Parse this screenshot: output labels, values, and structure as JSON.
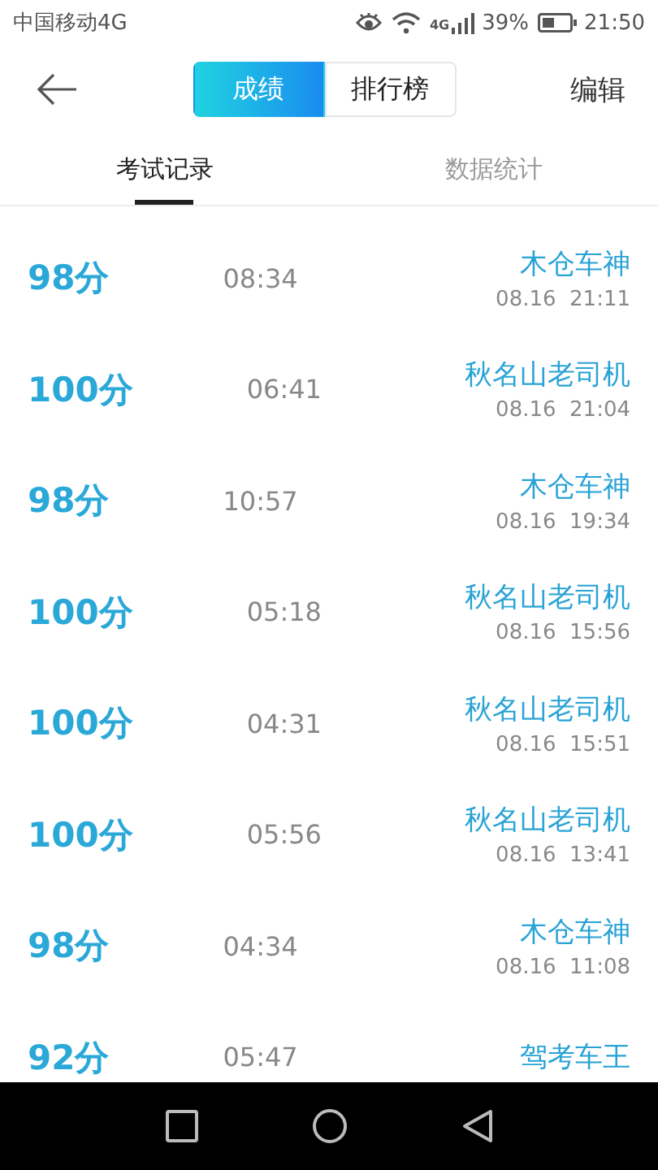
{
  "status_bar": {
    "carrier": "中国移动4G",
    "network": "4G",
    "battery": "39%",
    "time": "21:50"
  },
  "header": {
    "segments": [
      {
        "label": "成绩",
        "selected": true
      },
      {
        "label": "排行榜",
        "selected": false
      }
    ],
    "action": "编辑"
  },
  "tabs": [
    {
      "label": "考试记录",
      "selected": true
    },
    {
      "label": "数据统计",
      "selected": false
    }
  ],
  "records": [
    {
      "score": "98分",
      "duration": "08:34",
      "name": "木仓车神",
      "date": "08.16  21:11"
    },
    {
      "score": "100分",
      "duration": "06:41",
      "name": "秋名山老司机",
      "date": "08.16  21:04"
    },
    {
      "score": "98分",
      "duration": "10:57",
      "name": "木仓车神",
      "date": "08.16  19:34"
    },
    {
      "score": "100分",
      "duration": "05:18",
      "name": "秋名山老司机",
      "date": "08.16  15:56"
    },
    {
      "score": "100分",
      "duration": "04:31",
      "name": "秋名山老司机",
      "date": "08.16  15:51"
    },
    {
      "score": "100分",
      "duration": "05:56",
      "name": "秋名山老司机",
      "date": "08.16  13:41"
    },
    {
      "score": "98分",
      "duration": "04:34",
      "name": "木仓车神",
      "date": "08.16  11:08"
    },
    {
      "score": "92分",
      "duration": "05:47",
      "name": "驾考车王"
    }
  ]
}
